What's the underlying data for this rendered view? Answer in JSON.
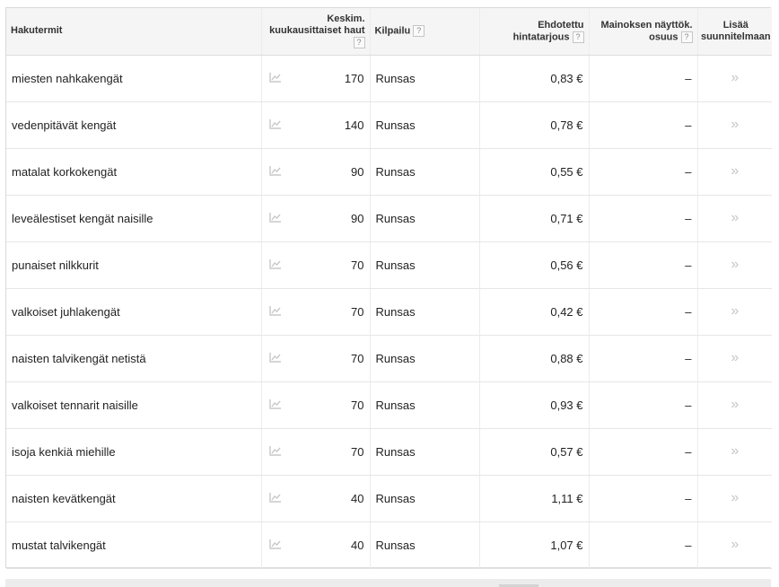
{
  "columns": {
    "keyword": "Hakutermit",
    "searches_line1": "Keskim.",
    "searches_line2": "kuukausittaiset haut",
    "competition": "Kilpailu",
    "bid_line1": "Ehdotettu",
    "bid_line2": "hintatarjous",
    "share_line1": "Mainoksen näyttök.",
    "share_line2": "osuus",
    "add_line1": "Lisää",
    "add_line2": "suunnitelmaan"
  },
  "help_symbol": "?",
  "icons": {
    "trend": "line-chart-icon",
    "add": "double-chevron-icon"
  },
  "colors": {
    "header_bg": "#f5f5f5",
    "chevron": "#c6c6c6",
    "chart_icon": "#c8c8c8"
  },
  "rows": [
    {
      "keyword": "miesten nahkakengät",
      "searches": "170",
      "competition": "Runsas",
      "bid": "0,83 €",
      "share": "–",
      "add": "»"
    },
    {
      "keyword": "vedenpitävät kengät",
      "searches": "140",
      "competition": "Runsas",
      "bid": "0,78 €",
      "share": "–",
      "add": "»"
    },
    {
      "keyword": "matalat korkokengät",
      "searches": "90",
      "competition": "Runsas",
      "bid": "0,55 €",
      "share": "–",
      "add": "»"
    },
    {
      "keyword": "leveälestiset kengät naisille",
      "searches": "90",
      "competition": "Runsas",
      "bid": "0,71 €",
      "share": "–",
      "add": "»"
    },
    {
      "keyword": "punaiset nilkkurit",
      "searches": "70",
      "competition": "Runsas",
      "bid": "0,56 €",
      "share": "–",
      "add": "»"
    },
    {
      "keyword": "valkoiset juhlakengät",
      "searches": "70",
      "competition": "Runsas",
      "bid": "0,42 €",
      "share": "–",
      "add": "»"
    },
    {
      "keyword": "naisten talvikengät netistä",
      "searches": "70",
      "competition": "Runsas",
      "bid": "0,88 €",
      "share": "–",
      "add": "»"
    },
    {
      "keyword": "valkoiset tennarit naisille",
      "searches": "70",
      "competition": "Runsas",
      "bid": "0,93 €",
      "share": "–",
      "add": "»"
    },
    {
      "keyword": "isoja kenkiä miehille",
      "searches": "70",
      "competition": "Runsas",
      "bid": "0,57 €",
      "share": "–",
      "add": "»"
    },
    {
      "keyword": "naisten kevätkengät",
      "searches": "40",
      "competition": "Runsas",
      "bid": "1,11 €",
      "share": "–",
      "add": "»"
    },
    {
      "keyword": "mustat talvikengät",
      "searches": "40",
      "competition": "Runsas",
      "bid": "1,07 €",
      "share": "–",
      "add": "»"
    }
  ]
}
